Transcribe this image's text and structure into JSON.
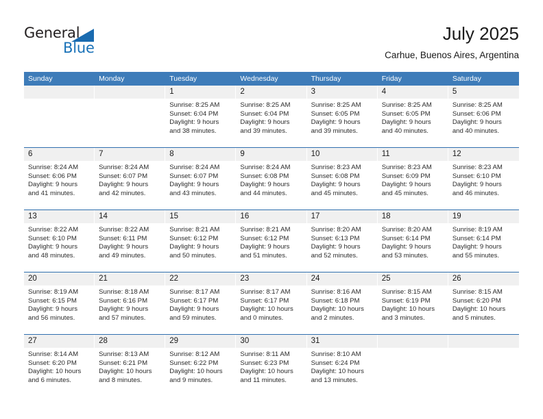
{
  "brand": {
    "word_general": "General",
    "word_blue": "Blue",
    "accent_color": "#1a72b8",
    "header_color": "#3e7cb9"
  },
  "header": {
    "title": "July 2025",
    "location": "Carhue, Buenos Aires, Argentina"
  },
  "calendar": {
    "day_headers": [
      "Sunday",
      "Monday",
      "Tuesday",
      "Wednesday",
      "Thursday",
      "Friday",
      "Saturday"
    ],
    "weeks": [
      [
        {
          "date": "",
          "lines": []
        },
        {
          "date": "",
          "lines": []
        },
        {
          "date": "1",
          "lines": [
            "Sunrise: 8:25 AM",
            "Sunset: 6:04 PM",
            "Daylight: 9 hours",
            "and 38 minutes."
          ]
        },
        {
          "date": "2",
          "lines": [
            "Sunrise: 8:25 AM",
            "Sunset: 6:04 PM",
            "Daylight: 9 hours",
            "and 39 minutes."
          ]
        },
        {
          "date": "3",
          "lines": [
            "Sunrise: 8:25 AM",
            "Sunset: 6:05 PM",
            "Daylight: 9 hours",
            "and 39 minutes."
          ]
        },
        {
          "date": "4",
          "lines": [
            "Sunrise: 8:25 AM",
            "Sunset: 6:05 PM",
            "Daylight: 9 hours",
            "and 40 minutes."
          ]
        },
        {
          "date": "5",
          "lines": [
            "Sunrise: 8:25 AM",
            "Sunset: 6:06 PM",
            "Daylight: 9 hours",
            "and 40 minutes."
          ]
        }
      ],
      [
        {
          "date": "6",
          "lines": [
            "Sunrise: 8:24 AM",
            "Sunset: 6:06 PM",
            "Daylight: 9 hours",
            "and 41 minutes."
          ]
        },
        {
          "date": "7",
          "lines": [
            "Sunrise: 8:24 AM",
            "Sunset: 6:07 PM",
            "Daylight: 9 hours",
            "and 42 minutes."
          ]
        },
        {
          "date": "8",
          "lines": [
            "Sunrise: 8:24 AM",
            "Sunset: 6:07 PM",
            "Daylight: 9 hours",
            "and 43 minutes."
          ]
        },
        {
          "date": "9",
          "lines": [
            "Sunrise: 8:24 AM",
            "Sunset: 6:08 PM",
            "Daylight: 9 hours",
            "and 44 minutes."
          ]
        },
        {
          "date": "10",
          "lines": [
            "Sunrise: 8:23 AM",
            "Sunset: 6:08 PM",
            "Daylight: 9 hours",
            "and 45 minutes."
          ]
        },
        {
          "date": "11",
          "lines": [
            "Sunrise: 8:23 AM",
            "Sunset: 6:09 PM",
            "Daylight: 9 hours",
            "and 45 minutes."
          ]
        },
        {
          "date": "12",
          "lines": [
            "Sunrise: 8:23 AM",
            "Sunset: 6:10 PM",
            "Daylight: 9 hours",
            "and 46 minutes."
          ]
        }
      ],
      [
        {
          "date": "13",
          "lines": [
            "Sunrise: 8:22 AM",
            "Sunset: 6:10 PM",
            "Daylight: 9 hours",
            "and 48 minutes."
          ]
        },
        {
          "date": "14",
          "lines": [
            "Sunrise: 8:22 AM",
            "Sunset: 6:11 PM",
            "Daylight: 9 hours",
            "and 49 minutes."
          ]
        },
        {
          "date": "15",
          "lines": [
            "Sunrise: 8:21 AM",
            "Sunset: 6:12 PM",
            "Daylight: 9 hours",
            "and 50 minutes."
          ]
        },
        {
          "date": "16",
          "lines": [
            "Sunrise: 8:21 AM",
            "Sunset: 6:12 PM",
            "Daylight: 9 hours",
            "and 51 minutes."
          ]
        },
        {
          "date": "17",
          "lines": [
            "Sunrise: 8:20 AM",
            "Sunset: 6:13 PM",
            "Daylight: 9 hours",
            "and 52 minutes."
          ]
        },
        {
          "date": "18",
          "lines": [
            "Sunrise: 8:20 AM",
            "Sunset: 6:14 PM",
            "Daylight: 9 hours",
            "and 53 minutes."
          ]
        },
        {
          "date": "19",
          "lines": [
            "Sunrise: 8:19 AM",
            "Sunset: 6:14 PM",
            "Daylight: 9 hours",
            "and 55 minutes."
          ]
        }
      ],
      [
        {
          "date": "20",
          "lines": [
            "Sunrise: 8:19 AM",
            "Sunset: 6:15 PM",
            "Daylight: 9 hours",
            "and 56 minutes."
          ]
        },
        {
          "date": "21",
          "lines": [
            "Sunrise: 8:18 AM",
            "Sunset: 6:16 PM",
            "Daylight: 9 hours",
            "and 57 minutes."
          ]
        },
        {
          "date": "22",
          "lines": [
            "Sunrise: 8:17 AM",
            "Sunset: 6:17 PM",
            "Daylight: 9 hours",
            "and 59 minutes."
          ]
        },
        {
          "date": "23",
          "lines": [
            "Sunrise: 8:17 AM",
            "Sunset: 6:17 PM",
            "Daylight: 10 hours",
            "and 0 minutes."
          ]
        },
        {
          "date": "24",
          "lines": [
            "Sunrise: 8:16 AM",
            "Sunset: 6:18 PM",
            "Daylight: 10 hours",
            "and 2 minutes."
          ]
        },
        {
          "date": "25",
          "lines": [
            "Sunrise: 8:15 AM",
            "Sunset: 6:19 PM",
            "Daylight: 10 hours",
            "and 3 minutes."
          ]
        },
        {
          "date": "26",
          "lines": [
            "Sunrise: 8:15 AM",
            "Sunset: 6:20 PM",
            "Daylight: 10 hours",
            "and 5 minutes."
          ]
        }
      ],
      [
        {
          "date": "27",
          "lines": [
            "Sunrise: 8:14 AM",
            "Sunset: 6:20 PM",
            "Daylight: 10 hours",
            "and 6 minutes."
          ]
        },
        {
          "date": "28",
          "lines": [
            "Sunrise: 8:13 AM",
            "Sunset: 6:21 PM",
            "Daylight: 10 hours",
            "and 8 minutes."
          ]
        },
        {
          "date": "29",
          "lines": [
            "Sunrise: 8:12 AM",
            "Sunset: 6:22 PM",
            "Daylight: 10 hours",
            "and 9 minutes."
          ]
        },
        {
          "date": "30",
          "lines": [
            "Sunrise: 8:11 AM",
            "Sunset: 6:23 PM",
            "Daylight: 10 hours",
            "and 11 minutes."
          ]
        },
        {
          "date": "31",
          "lines": [
            "Sunrise: 8:10 AM",
            "Sunset: 6:24 PM",
            "Daylight: 10 hours",
            "and 13 minutes."
          ]
        },
        {
          "date": "",
          "lines": []
        },
        {
          "date": "",
          "lines": []
        }
      ]
    ]
  }
}
